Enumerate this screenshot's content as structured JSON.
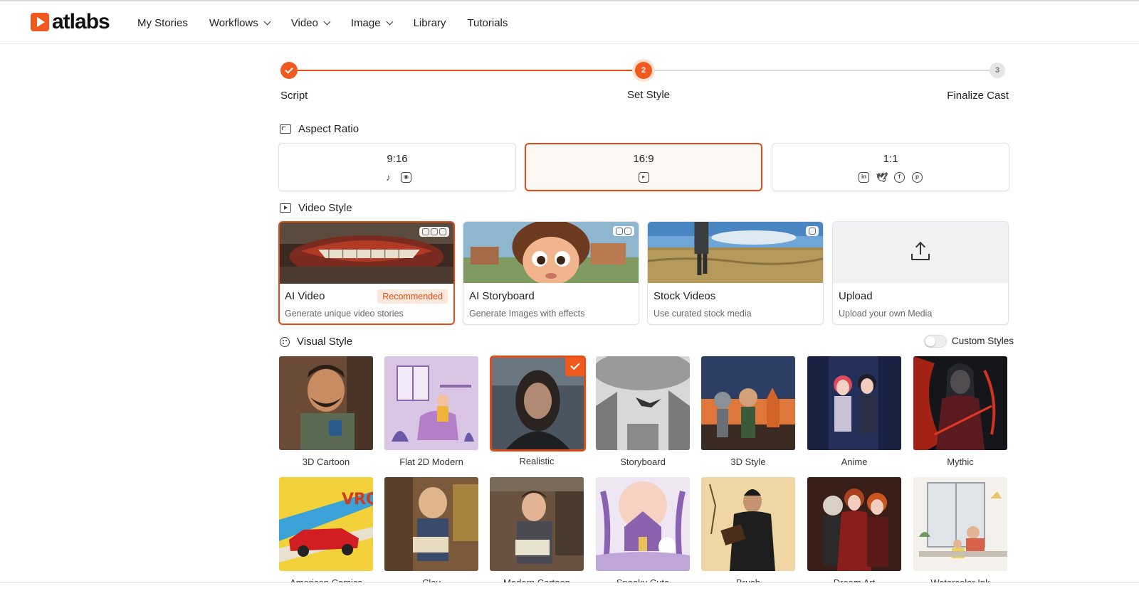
{
  "brand": {
    "name": "atlabs",
    "color": "#f05a1e"
  },
  "nav": [
    {
      "label": "My Stories",
      "dropdown": false
    },
    {
      "label": "Workflows",
      "dropdown": true
    },
    {
      "label": "Video",
      "dropdown": true
    },
    {
      "label": "Image",
      "dropdown": true
    },
    {
      "label": "Library",
      "dropdown": false
    },
    {
      "label": "Tutorials",
      "dropdown": false
    }
  ],
  "stepper": {
    "steps": [
      {
        "label": "Script",
        "number": "1",
        "state": "done"
      },
      {
        "label": "Set Style",
        "number": "2",
        "state": "active"
      },
      {
        "label": "Finalize Cast",
        "number": "3",
        "state": "todo"
      }
    ]
  },
  "aspect_ratio": {
    "heading": "Aspect Ratio",
    "options": [
      {
        "label": "9:16",
        "icons": [
          "tiktok-icon",
          "instagram-icon"
        ],
        "selected": false
      },
      {
        "label": "16:9",
        "icons": [
          "youtube-icon"
        ],
        "selected": true
      },
      {
        "label": "1:1",
        "icons": [
          "linkedin-icon",
          "twitter-icon",
          "facebook-icon",
          "pinterest-icon"
        ],
        "selected": false
      }
    ]
  },
  "video_style": {
    "heading": "Video Style",
    "options": [
      {
        "title": "AI Video",
        "subtitle": "Generate unique video stories",
        "badge": "Recommended",
        "credits": 3,
        "selected": true
      },
      {
        "title": "AI Storyboard",
        "subtitle": "Generate Images with effects",
        "badge": "",
        "credits": 2,
        "selected": false
      },
      {
        "title": "Stock Videos",
        "subtitle": "Use curated stock media",
        "badge": "",
        "credits": 1,
        "selected": false
      },
      {
        "title": "Upload",
        "subtitle": "Upload your own Media",
        "badge": "",
        "credits": 0,
        "selected": false
      }
    ]
  },
  "visual_style": {
    "heading": "Visual Style",
    "custom_styles_label": "Custom Styles",
    "custom_styles_on": false,
    "row1": [
      {
        "label": "3D Cartoon",
        "selected": false
      },
      {
        "label": "Flat 2D Modern",
        "selected": false
      },
      {
        "label": "Realistic",
        "selected": true
      },
      {
        "label": "Storyboard",
        "selected": false
      },
      {
        "label": "3D Style",
        "selected": false
      },
      {
        "label": "Anime",
        "selected": false
      },
      {
        "label": "Mythic",
        "selected": false
      }
    ],
    "row2": [
      {
        "label": "American Comics",
        "selected": false
      },
      {
        "label": "Clay",
        "selected": false
      },
      {
        "label": "Modern Cartoon",
        "selected": false
      },
      {
        "label": "Spooky Cute",
        "selected": false
      },
      {
        "label": "Brush",
        "selected": false
      },
      {
        "label": "Dream Art",
        "selected": false
      },
      {
        "label": "Watercolor Ink",
        "selected": false
      }
    ]
  }
}
